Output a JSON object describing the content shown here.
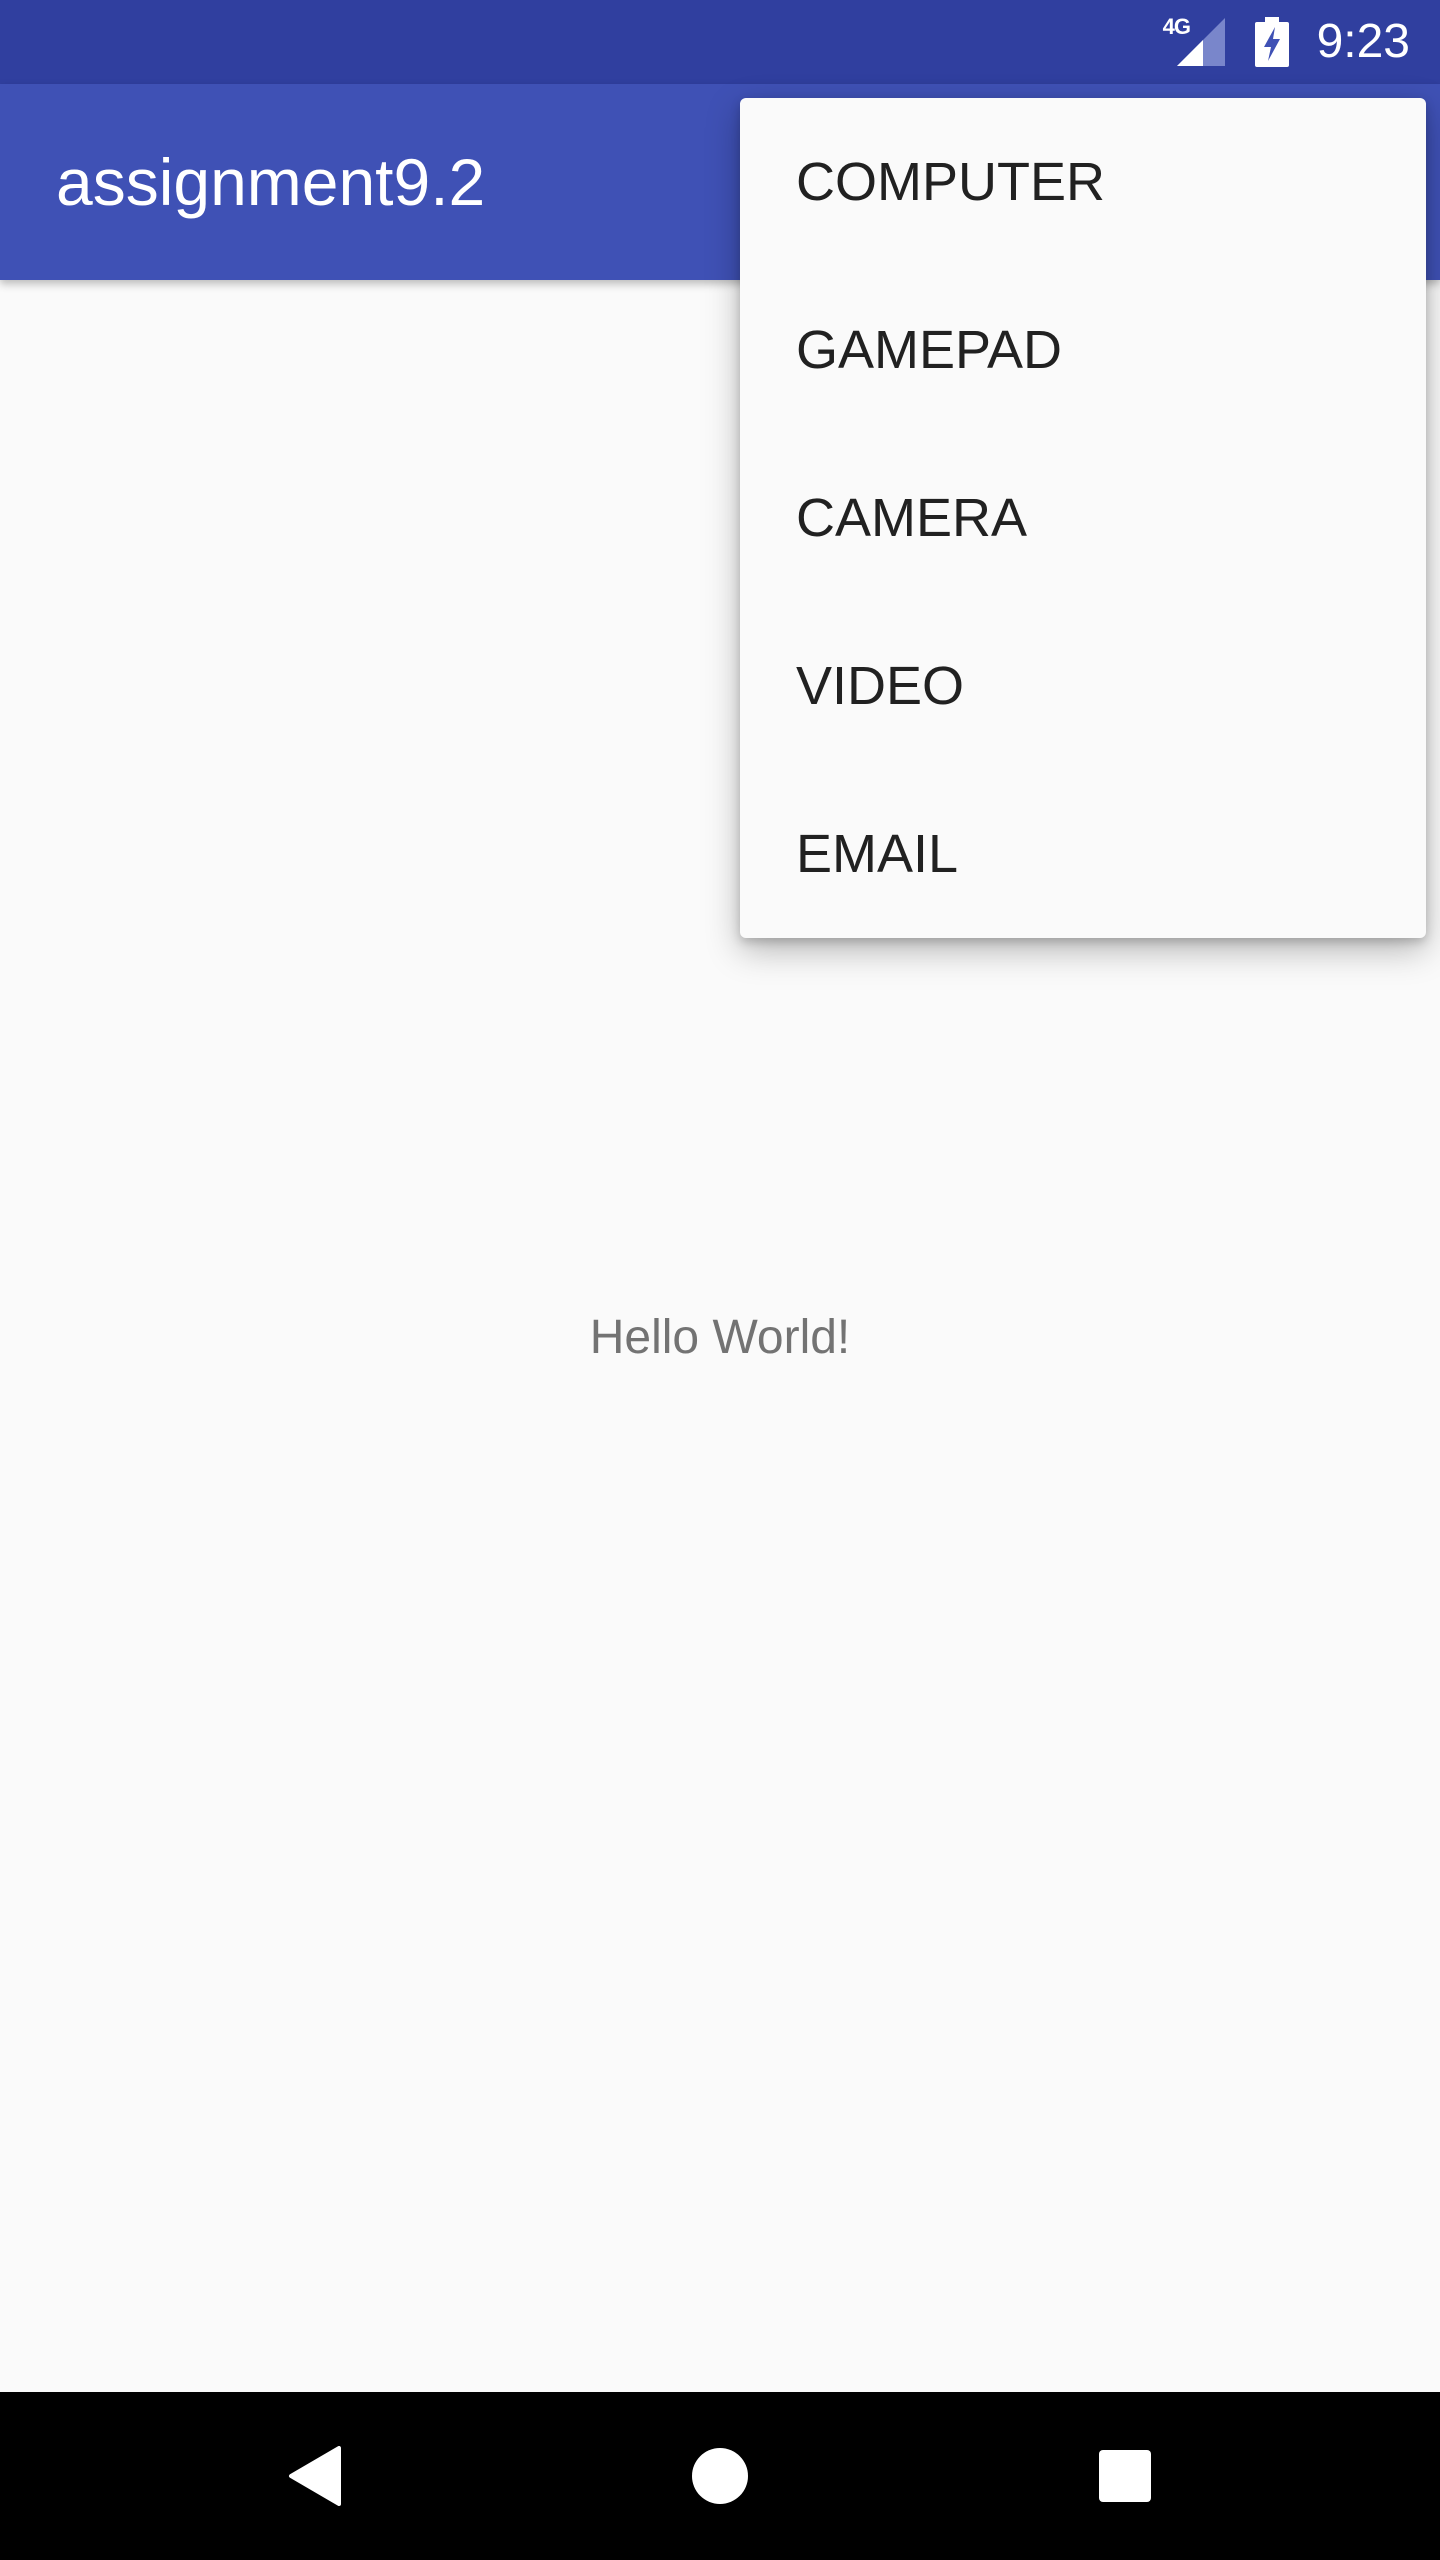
{
  "status_bar": {
    "network_label": "4G",
    "time": "9:23"
  },
  "app_bar": {
    "title": "assignment9.2"
  },
  "content": {
    "message": "Hello World!"
  },
  "overflow_menu": {
    "items": [
      {
        "label": "COMPUTER"
      },
      {
        "label": "GAMEPAD"
      },
      {
        "label": "CAMERA"
      },
      {
        "label": "VIDEO"
      },
      {
        "label": "EMAIL"
      }
    ]
  },
  "navigation_bar": {
    "icons": [
      "back-icon",
      "home-icon",
      "recents-icon"
    ]
  },
  "colors": {
    "status_bar": "#303f9f",
    "app_bar": "#3f51b5",
    "background": "#fafafa",
    "menu_text": "#212121",
    "hello_text": "#737373"
  }
}
